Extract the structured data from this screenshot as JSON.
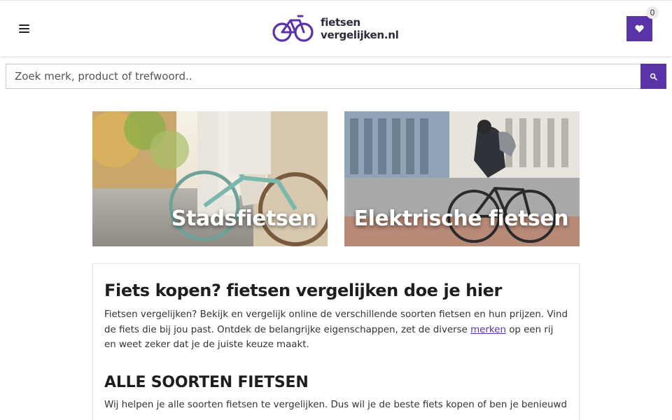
{
  "header": {
    "menu_icon": "hamburger-icon",
    "logo": {
      "line1": "fietsen",
      "line2": "vergelijken.nl",
      "icon": "bicycle-logo-icon"
    },
    "favorites": {
      "icon": "heart-icon",
      "count": "0"
    }
  },
  "search": {
    "placeholder": "Zoek merk, product of trefwoord..",
    "icon": "search-icon"
  },
  "categories": [
    {
      "label": "Stadsfietsen"
    },
    {
      "label": "Elektrische fietsen"
    }
  ],
  "article": {
    "title": "Fiets kopen? fietsen vergelijken doe je hier",
    "intro_before_link": "Fietsen vergelijken? Bekijk en vergelijk online de verschillende soorten fietsen en hun prijzen. Vind de fiets die bij jou past. Ontdek de belangrijke eigenschappen, zet de diverse ",
    "intro_link": "merken",
    "intro_after_link": " op een rij en weet zeker dat je de juiste keuze maakt.",
    "section_title": "ALLE SOORTEN FIETSEN",
    "section_text": "Wij helpen je alle soorten fietsen te vergelijken. Dus wil je de beste fiets kopen of ben je benieuwd"
  },
  "colors": {
    "accent": "#5b33a8",
    "text": "#222222",
    "border": "#c9c9c9"
  }
}
